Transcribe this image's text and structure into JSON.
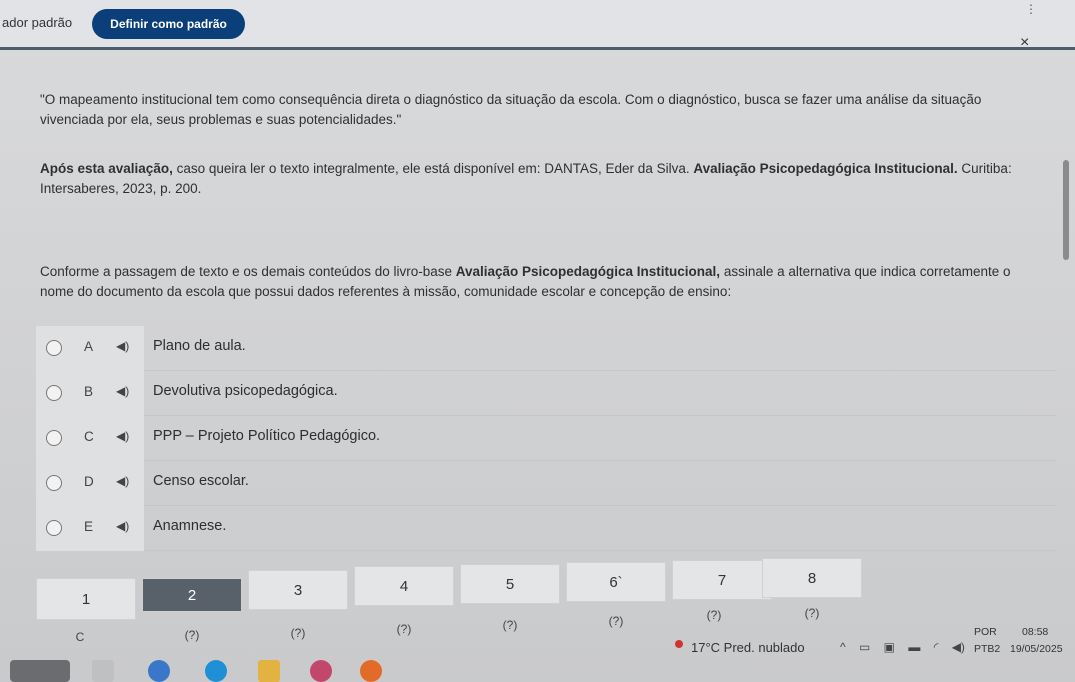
{
  "topbar": {
    "default_label": "ador padrão",
    "default_button": "Definir como padrão",
    "kebab": "⋮",
    "close": "×"
  },
  "content": {
    "quote": "\"O mapeamento institucional tem como consequência direta o diagnóstico da situação da escola. Com o diagnóstico, busca se fazer uma análise da situação vivenciada por ela, seus problemas e suas potencialidades.\"",
    "source_bold": "Após esta avaliação,",
    "source_text": " caso queira ler o texto integralmente, ele está disponível em: DANTAS, Eder da Silva. ",
    "source_title": "Avaliação Psicopedagógica Institucional.",
    "source_end": " Curitiba: Intersaberes, 2023, p. 200.",
    "question_a": "Conforme a passagem de texto e os demais conteúdos do livro-base ",
    "question_bold": "Avaliação Psicopedagógica Institucional,",
    "question_b": " assinale a alternativa que indica corretamente o nome do documento da escola que possui dados referentes à missão, comunidade escolar e concepção de ensino:"
  },
  "options": [
    {
      "letter": "A",
      "text": "Plano de aula."
    },
    {
      "letter": "B",
      "text": "Devolutiva psicopedagógica."
    },
    {
      "letter": "C",
      "text": "PPP – Projeto Político Pedagógico."
    },
    {
      "letter": "D",
      "text": "Censo escolar."
    },
    {
      "letter": "E",
      "text": "Anamnese."
    }
  ],
  "speaker_icon": "speaker-icon",
  "navigator": [
    {
      "number": "1",
      "status": "C"
    },
    {
      "number": "2",
      "status": "(?)"
    },
    {
      "number": "3",
      "status": "(?)"
    },
    {
      "number": "4",
      "status": "(?)"
    },
    {
      "number": "5",
      "status": "(?)"
    },
    {
      "number": "6`",
      "status": "(?)"
    },
    {
      "number": "7",
      "status": "(?)"
    },
    {
      "number": "8",
      "status": "(?)"
    }
  ],
  "taskbar": {
    "weather": "17°C  Pred. nublado",
    "lang_1": "POR",
    "lang_2": "PTB2",
    "time": "08:58",
    "date": "19/05/2025"
  },
  "colors": {
    "accent": "#0b3f7a",
    "active_question": "#58606a"
  }
}
